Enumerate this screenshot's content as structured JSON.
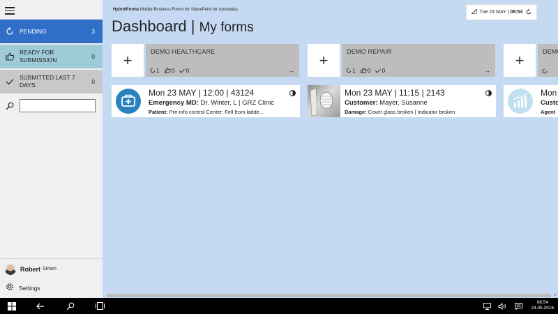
{
  "sidebar": {
    "nav": [
      {
        "label": "Pending",
        "count": "3"
      },
      {
        "label": "Ready for submission",
        "count": "0"
      },
      {
        "label": "Submitted last 7 days",
        "count": "0"
      }
    ],
    "search_value": "",
    "user": {
      "first": "Robert",
      "last": "Simon"
    },
    "settings_label": "Settings"
  },
  "header": {
    "brand_bold": "HybridForms",
    "brand_rest": " Mobile Business Forms for SharePoint for icomedias",
    "title": "Dashboard",
    "separator": " | ",
    "subtitle": "My forms",
    "date": "Tue 24 MAY |",
    "time": "08:54"
  },
  "projects": [
    {
      "name": "DEMO HEALTHCARE",
      "pending": "1",
      "ready": "0",
      "done": "0",
      "add_label": "+"
    },
    {
      "name": "DEMO REPAIR",
      "pending": "1",
      "ready": "0",
      "done": "0",
      "add_label": "+"
    },
    {
      "name": "DEMO",
      "pending": "",
      "ready": "",
      "done": "",
      "add_label": "+"
    }
  ],
  "forms": [
    {
      "title": "Mon 23 MAY | 12:00 | 43124",
      "line2_label": "Emergency MD:",
      "line2_value": " Dr. Winter, L | GRZ Clinic",
      "line3_label": "Patient:",
      "line3_value": " Pre-info control Center: Fell from ladde..."
    },
    {
      "title": "Mon 23 MAY | 11:15 | 2143",
      "line2_label": "Customer:",
      "line2_value": " Mayer, Susanne",
      "line3_label": "Damage:",
      "line3_value": " Cover glass broken | Indicator broken"
    },
    {
      "title": "Mon",
      "line2_label": "Custo",
      "line2_value": "",
      "line3_label": "Agent",
      "line3_value": ""
    }
  ],
  "taskbar": {
    "clock_time": "08:54",
    "clock_date": "24.05.2016"
  },
  "colors": {
    "accent": "#2f6fc7",
    "ready": "#9fcbd9",
    "submitted": "#c8c8c8",
    "canvas": "#c5daf2",
    "healthcare_icon": "#2a83c0",
    "chart_icon": "#bfe0ee"
  }
}
